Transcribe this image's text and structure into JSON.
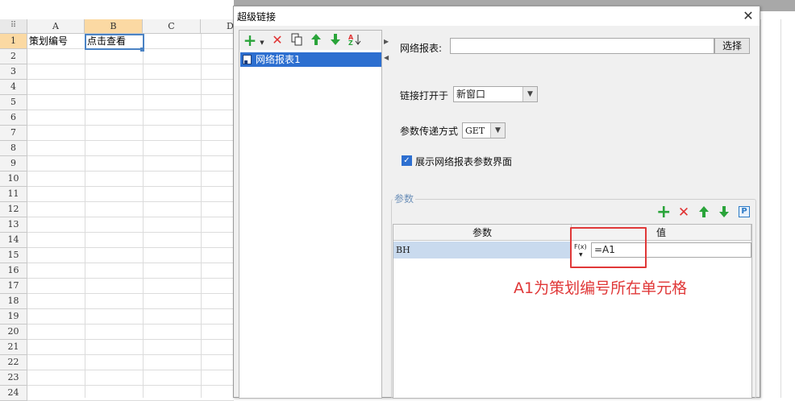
{
  "spreadsheet": {
    "columns": [
      "A",
      "B",
      "C",
      "D"
    ],
    "rows": [
      "1",
      "2",
      "3",
      "4",
      "5",
      "6",
      "7",
      "8",
      "9",
      "10",
      "11",
      "12",
      "13",
      "14",
      "15",
      "16",
      "17",
      "18",
      "19",
      "20",
      "21",
      "22",
      "23",
      "24"
    ],
    "cells": {
      "A1": "策划编号",
      "B1": "点击查看"
    },
    "selected_cell": "B1"
  },
  "dialog": {
    "title": "超级链接",
    "close_glyph": "✕",
    "left_toolbar": {
      "add_icon": "plus-icon",
      "delete_icon": "delete-icon",
      "copy_icon": "copy-icon",
      "up_icon": "arrow-up-icon",
      "down_icon": "arrow-down-icon",
      "sort_icon": "sort-icon"
    },
    "tree_items": [
      "网络报表1"
    ],
    "report_label": "网络报表:",
    "report_value": "",
    "select_button": "选择",
    "open_in_label": "链接打开于",
    "open_in_value": "新窗口",
    "method_label": "参数传递方式",
    "method_value": "GET",
    "show_params_label": "展示网络报表参数界面",
    "show_params_checked": true,
    "params_group_title": "参数",
    "params_table": {
      "headers": [
        "参数",
        "值"
      ],
      "rows": [
        {
          "param": "BH",
          "fx": "F(x)",
          "value": "=A1"
        }
      ]
    }
  },
  "annotation": {
    "text": "A1为策划编号所在单元格",
    "color": "#e03838"
  }
}
